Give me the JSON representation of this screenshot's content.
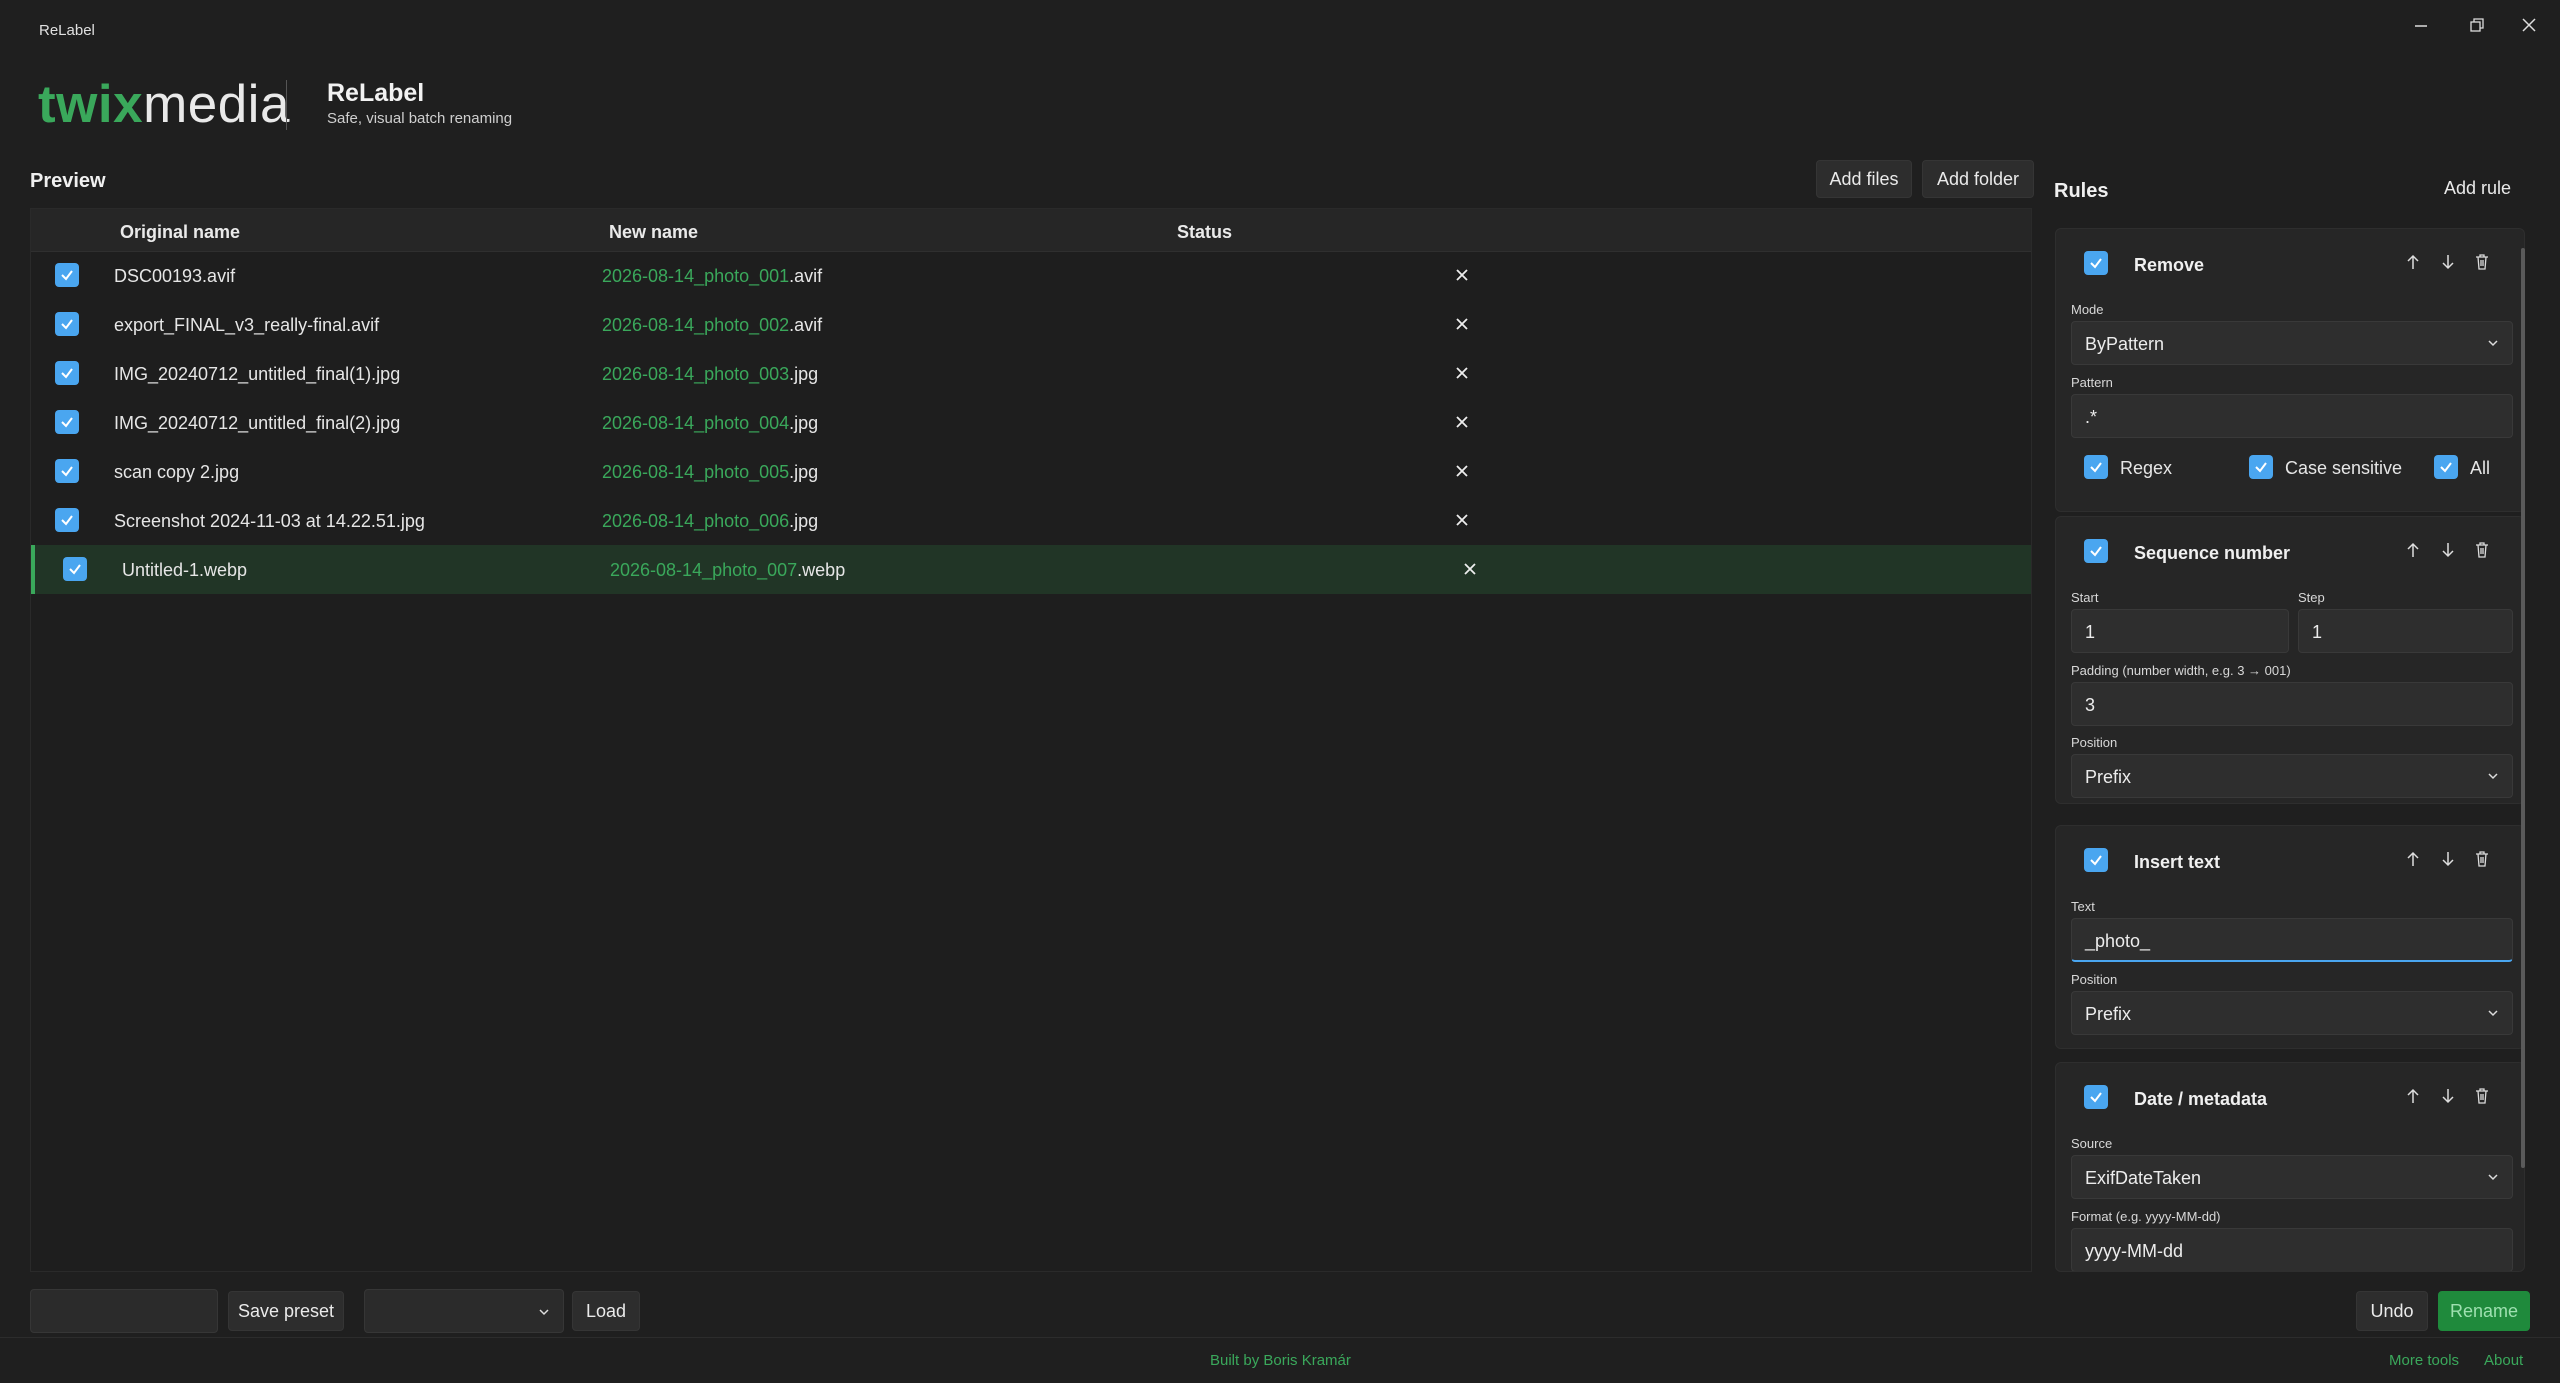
{
  "window": {
    "title": "ReLabel"
  },
  "brand": {
    "logo_part1": "twix",
    "logo_part2": "media",
    "app_name": "ReLabel",
    "tagline": "Safe, visual batch renaming"
  },
  "preview": {
    "title": "Preview",
    "add_files_label": "Add files",
    "add_folder_label": "Add folder",
    "columns": [
      "Original name",
      "New name",
      "Status"
    ],
    "rows": [
      {
        "original": "DSC00193.avif",
        "new_base": "2026-08-14_photo_001",
        "new_ext": ".avif"
      },
      {
        "original": "export_FINAL_v3_really-final.avif",
        "new_base": "2026-08-14_photo_002",
        "new_ext": ".avif"
      },
      {
        "original": "IMG_20240712_untitled_final(1).jpg",
        "new_base": "2026-08-14_photo_003",
        "new_ext": ".jpg"
      },
      {
        "original": "IMG_20240712_untitled_final(2).jpg",
        "new_base": "2026-08-14_photo_004",
        "new_ext": ".jpg"
      },
      {
        "original": "scan copy 2.jpg",
        "new_base": "2026-08-14_photo_005",
        "new_ext": ".jpg"
      },
      {
        "original": "Screenshot 2024-11-03 at 14.22.51.jpg",
        "new_base": "2026-08-14_photo_006",
        "new_ext": ".jpg"
      },
      {
        "original": "Untitled-1.webp",
        "new_base": "2026-08-14_photo_007",
        "new_ext": ".webp"
      }
    ]
  },
  "bottom": {
    "preset_name_value": "",
    "save_preset_label": "Save preset",
    "preset_select_value": "",
    "load_label": "Load",
    "undo_label": "Undo",
    "rename_label": "Rename"
  },
  "footer": {
    "credit": "Built by Boris Kramár",
    "more_tools": "More tools",
    "about": "About"
  },
  "rules": {
    "title": "Rules",
    "add_rule_label": "Add rule",
    "remove": {
      "title": "Remove",
      "mode_label": "Mode",
      "mode_value": "ByPattern",
      "pattern_label": "Pattern",
      "pattern_value": ".*",
      "regex_label": "Regex",
      "case_label": "Case sensitive",
      "all_label": "All"
    },
    "sequence": {
      "title": "Sequence number",
      "start_label": "Start",
      "start_value": "1",
      "step_label": "Step",
      "step_value": "1",
      "padding_label": "Padding (number width, e.g. 3 → 001)",
      "padding_value": "3",
      "position_label": "Position",
      "position_value": "Prefix"
    },
    "insert": {
      "title": "Insert text",
      "text_label": "Text",
      "text_value": "_photo_",
      "position_label": "Position",
      "position_value": "Prefix"
    },
    "date": {
      "title": "Date / metadata",
      "source_label": "Source",
      "source_value": "ExifDateTaken",
      "format_label": "Format (e.g. yyyy-MM-dd)",
      "format_value": "yyyy-MM-dd"
    }
  },
  "colors": {
    "accent": "#3aa85b",
    "checkbox": "#4aa6f0",
    "background": "#1f1f1f"
  }
}
